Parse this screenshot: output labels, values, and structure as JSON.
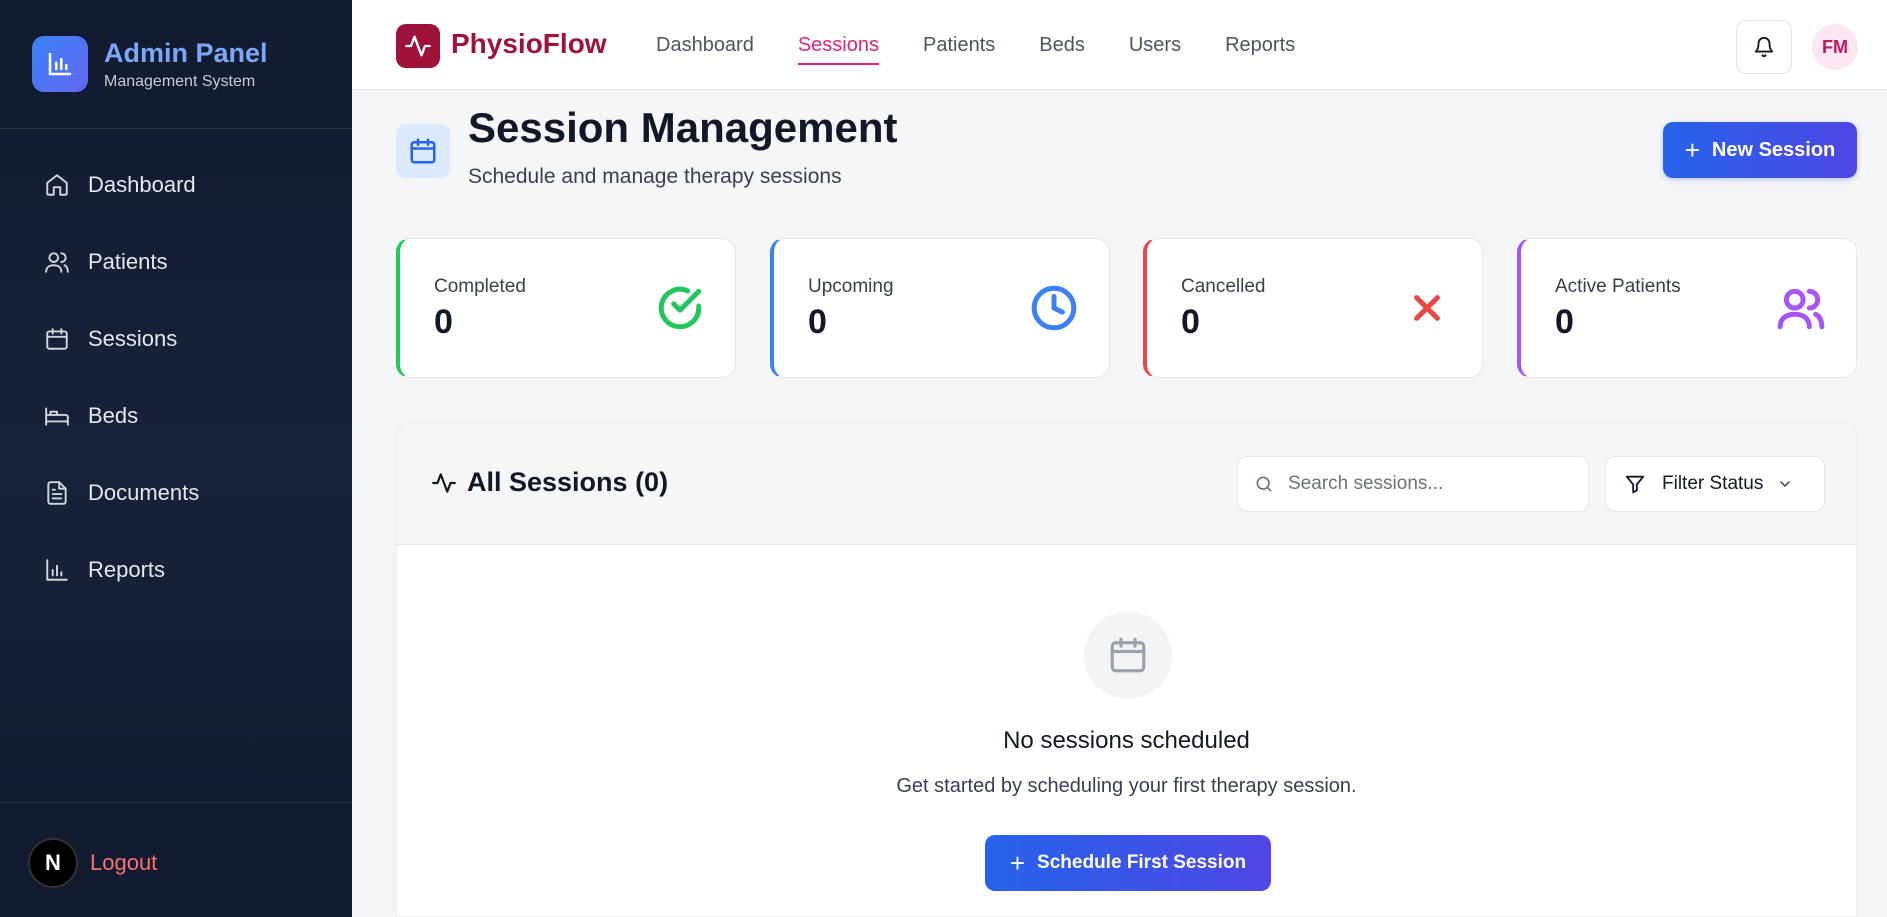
{
  "sidebar": {
    "title": "Admin Panel",
    "subtitle": "Management System",
    "items": [
      {
        "label": "Dashboard",
        "icon": "home-icon"
      },
      {
        "label": "Patients",
        "icon": "users-icon"
      },
      {
        "label": "Sessions",
        "icon": "calendar-icon"
      },
      {
        "label": "Beds",
        "icon": "bed-icon"
      },
      {
        "label": "Documents",
        "icon": "document-icon"
      },
      {
        "label": "Reports",
        "icon": "bar-chart-icon"
      }
    ],
    "logout_avatar": "N",
    "logout_label": "Logout"
  },
  "topbar": {
    "app_name": "PhysioFlow",
    "nav": [
      "Dashboard",
      "Sessions",
      "Patients",
      "Beds",
      "Users",
      "Reports"
    ],
    "active_nav": "Sessions",
    "user_initials": "FM"
  },
  "page": {
    "title": "Session Management",
    "subtitle": "Schedule and manage therapy sessions",
    "new_session_label": "New Session"
  },
  "stats": [
    {
      "label": "Completed",
      "value": "0",
      "color": "#22c55e",
      "icon": "check-circle-icon"
    },
    {
      "label": "Upcoming",
      "value": "0",
      "color": "#3b82f6",
      "icon": "clock-icon"
    },
    {
      "label": "Cancelled",
      "value": "0",
      "color": "#ef4444",
      "icon": "x-icon"
    },
    {
      "label": "Active Patients",
      "value": "0",
      "color": "#a855f7",
      "icon": "users-icon"
    }
  ],
  "sessions": {
    "title": "All Sessions (0)",
    "search_placeholder": "Search sessions...",
    "filter_label": "Filter Status",
    "empty_title": "No sessions scheduled",
    "empty_subtitle": "Get started by scheduling your first therapy session.",
    "schedule_label": "Schedule First Session"
  }
}
